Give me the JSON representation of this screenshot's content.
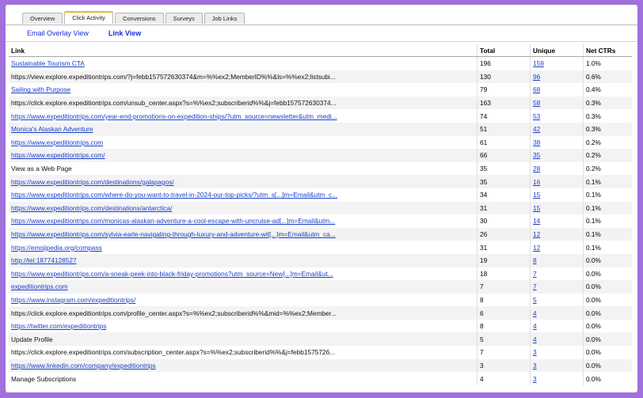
{
  "tabs": [
    {
      "label": "Overview",
      "active": false
    },
    {
      "label": "Click Activity",
      "active": true
    },
    {
      "label": "Conversions",
      "active": false
    },
    {
      "label": "Surveys",
      "active": false
    },
    {
      "label": "Job Links",
      "active": false
    }
  ],
  "subnav": [
    {
      "label": "Email Overlay View",
      "bold": false
    },
    {
      "label": "Link View",
      "bold": true
    }
  ],
  "columns": {
    "link": "Link",
    "total": "Total",
    "unique": "Unique",
    "ctr": "Net CTRs"
  },
  "accent_colors": {
    "tab_active": "#f2b51a",
    "link": "#1a3fc8",
    "frame": "#a070dc"
  },
  "rows": [
    {
      "link": "Sustainable Tourism CTA",
      "is_link": true,
      "total": "196",
      "unique": "159",
      "ctr": "1.0%"
    },
    {
      "link": "https://view.explore.expeditiontrips.com/?j=febb157572630374&m=%%ex2;MemberID%%&ls=%%ex2;listsubi...",
      "is_link": false,
      "total": "130",
      "unique": "96",
      "ctr": "0.6%"
    },
    {
      "link": "Sailing with Purpose",
      "is_link": true,
      "total": "79",
      "unique": "68",
      "ctr": "0.4%"
    },
    {
      "link": "https://click.explore.expeditiontrips.com/unsub_center.aspx?s=%%ex2;subscriberid%%&j=febb157572630374...",
      "is_link": false,
      "total": "163",
      "unique": "58",
      "ctr": "0.3%"
    },
    {
      "link": "https://www.expeditiontrips.com/year-end-promotions-on-expedition-ships/?utm_source=newsletter&utm_medi...",
      "is_link": true,
      "total": "74",
      "unique": "53",
      "ctr": "0.3%"
    },
    {
      "link": "Monica's Alaskan Adventure",
      "is_link": true,
      "total": "51",
      "unique": "42",
      "ctr": "0.3%"
    },
    {
      "link": "https://www.expeditiontrips.com",
      "is_link": true,
      "total": "61",
      "unique": "38",
      "ctr": "0.2%"
    },
    {
      "link": "https://www.expeditiontrips.com/",
      "is_link": true,
      "total": "66",
      "unique": "35",
      "ctr": "0.2%"
    },
    {
      "link": "View as a Web Page",
      "is_link": false,
      "total": "35",
      "unique": "28",
      "ctr": "0.2%"
    },
    {
      "link": "https://www.expeditiontrips.com/destinations/galapagos/",
      "is_link": true,
      "total": "35",
      "unique": "16",
      "ctr": "0.1%"
    },
    {
      "link": "https://www.expeditiontrips.com/where-do-you-want-to-travel-in-2024-our-top-picks/?utm_s[...]m=Email&utm_c...",
      "is_link": true,
      "total": "34",
      "unique": "15",
      "ctr": "0.1%"
    },
    {
      "link": "https://www.expeditiontrips.com/destinations/antarctica/",
      "is_link": true,
      "total": "31",
      "unique": "15",
      "ctr": "0.1%"
    },
    {
      "link": "https://www.expeditiontrips.com/monicas-alaskan-adventure-a-cool-escape-with-uncruise-ad[...]m=Email&utm...",
      "is_link": true,
      "total": "30",
      "unique": "14",
      "ctr": "0.1%"
    },
    {
      "link": "https://www.expeditiontrips.com/sylvia-earle-navigating-through-luxury-and-adventure-wit[...]m=Email&utm_ca...",
      "is_link": true,
      "total": "26",
      "unique": "12",
      "ctr": "0.1%"
    },
    {
      "link": "https://emojipedia.org/compass",
      "is_link": true,
      "total": "31",
      "unique": "12",
      "ctr": "0.1%"
    },
    {
      "link": "http://tel:18774128527",
      "is_link": true,
      "total": "19",
      "unique": "8",
      "ctr": "0.0%"
    },
    {
      "link": "https://www.expeditiontrips.com/a-sneak-peek-into-black-friday-promotions?utm_source=New[...]m=Email&ut...",
      "is_link": true,
      "total": "18",
      "unique": "7",
      "ctr": "0.0%"
    },
    {
      "link": "expeditiontrips.com",
      "is_link": true,
      "total": "7",
      "unique": "7",
      "ctr": "0.0%"
    },
    {
      "link": "https://www.instagram.com/expeditiontrips/",
      "is_link": true,
      "total": "8",
      "unique": "5",
      "ctr": "0.0%"
    },
    {
      "link": "https://click.explore.expeditiontrips.com/profile_center.aspx?s=%%ex2;subscriberid%%&mid=%%ex2;Member...",
      "is_link": false,
      "total": "6",
      "unique": "4",
      "ctr": "0.0%"
    },
    {
      "link": "https://twitter.com/expeditiontrips",
      "is_link": true,
      "total": "8",
      "unique": "4",
      "ctr": "0.0%"
    },
    {
      "link": "Update Profile",
      "is_link": false,
      "total": "5",
      "unique": "4",
      "ctr": "0.0%"
    },
    {
      "link": "https://click.explore.expeditiontrips.com/subscription_center.aspx?s=%%ex2;subscriberid%%&j=febb1575726...",
      "is_link": false,
      "total": "7",
      "unique": "3",
      "ctr": "0.0%"
    },
    {
      "link": "https://www.linkedin.com/company/expeditiontrips",
      "is_link": true,
      "total": "3",
      "unique": "3",
      "ctr": "0.0%"
    },
    {
      "link": "Manage Subscriptions",
      "is_link": false,
      "total": "4",
      "unique": "3",
      "ctr": "0.0%"
    }
  ]
}
